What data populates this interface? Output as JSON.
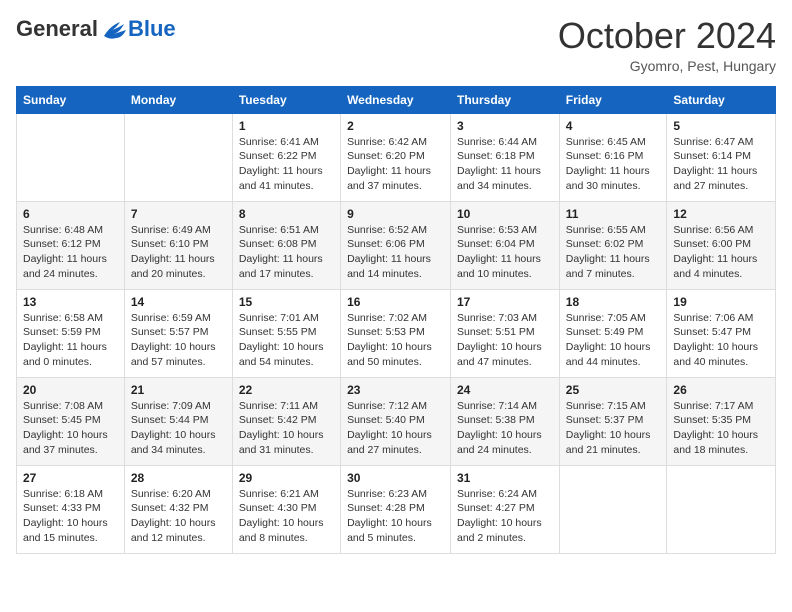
{
  "header": {
    "logo_general": "General",
    "logo_blue": "Blue",
    "month": "October 2024",
    "location": "Gyomro, Pest, Hungary"
  },
  "weekdays": [
    "Sunday",
    "Monday",
    "Tuesday",
    "Wednesday",
    "Thursday",
    "Friday",
    "Saturday"
  ],
  "weeks": [
    [
      {
        "day": "",
        "info": ""
      },
      {
        "day": "",
        "info": ""
      },
      {
        "day": "1",
        "info": "Sunrise: 6:41 AM\nSunset: 6:22 PM\nDaylight: 11 hours and 41 minutes."
      },
      {
        "day": "2",
        "info": "Sunrise: 6:42 AM\nSunset: 6:20 PM\nDaylight: 11 hours and 37 minutes."
      },
      {
        "day": "3",
        "info": "Sunrise: 6:44 AM\nSunset: 6:18 PM\nDaylight: 11 hours and 34 minutes."
      },
      {
        "day": "4",
        "info": "Sunrise: 6:45 AM\nSunset: 6:16 PM\nDaylight: 11 hours and 30 minutes."
      },
      {
        "day": "5",
        "info": "Sunrise: 6:47 AM\nSunset: 6:14 PM\nDaylight: 11 hours and 27 minutes."
      }
    ],
    [
      {
        "day": "6",
        "info": "Sunrise: 6:48 AM\nSunset: 6:12 PM\nDaylight: 11 hours and 24 minutes."
      },
      {
        "day": "7",
        "info": "Sunrise: 6:49 AM\nSunset: 6:10 PM\nDaylight: 11 hours and 20 minutes."
      },
      {
        "day": "8",
        "info": "Sunrise: 6:51 AM\nSunset: 6:08 PM\nDaylight: 11 hours and 17 minutes."
      },
      {
        "day": "9",
        "info": "Sunrise: 6:52 AM\nSunset: 6:06 PM\nDaylight: 11 hours and 14 minutes."
      },
      {
        "day": "10",
        "info": "Sunrise: 6:53 AM\nSunset: 6:04 PM\nDaylight: 11 hours and 10 minutes."
      },
      {
        "day": "11",
        "info": "Sunrise: 6:55 AM\nSunset: 6:02 PM\nDaylight: 11 hours and 7 minutes."
      },
      {
        "day": "12",
        "info": "Sunrise: 6:56 AM\nSunset: 6:00 PM\nDaylight: 11 hours and 4 minutes."
      }
    ],
    [
      {
        "day": "13",
        "info": "Sunrise: 6:58 AM\nSunset: 5:59 PM\nDaylight: 11 hours and 0 minutes."
      },
      {
        "day": "14",
        "info": "Sunrise: 6:59 AM\nSunset: 5:57 PM\nDaylight: 10 hours and 57 minutes."
      },
      {
        "day": "15",
        "info": "Sunrise: 7:01 AM\nSunset: 5:55 PM\nDaylight: 10 hours and 54 minutes."
      },
      {
        "day": "16",
        "info": "Sunrise: 7:02 AM\nSunset: 5:53 PM\nDaylight: 10 hours and 50 minutes."
      },
      {
        "day": "17",
        "info": "Sunrise: 7:03 AM\nSunset: 5:51 PM\nDaylight: 10 hours and 47 minutes."
      },
      {
        "day": "18",
        "info": "Sunrise: 7:05 AM\nSunset: 5:49 PM\nDaylight: 10 hours and 44 minutes."
      },
      {
        "day": "19",
        "info": "Sunrise: 7:06 AM\nSunset: 5:47 PM\nDaylight: 10 hours and 40 minutes."
      }
    ],
    [
      {
        "day": "20",
        "info": "Sunrise: 7:08 AM\nSunset: 5:45 PM\nDaylight: 10 hours and 37 minutes."
      },
      {
        "day": "21",
        "info": "Sunrise: 7:09 AM\nSunset: 5:44 PM\nDaylight: 10 hours and 34 minutes."
      },
      {
        "day": "22",
        "info": "Sunrise: 7:11 AM\nSunset: 5:42 PM\nDaylight: 10 hours and 31 minutes."
      },
      {
        "day": "23",
        "info": "Sunrise: 7:12 AM\nSunset: 5:40 PM\nDaylight: 10 hours and 27 minutes."
      },
      {
        "day": "24",
        "info": "Sunrise: 7:14 AM\nSunset: 5:38 PM\nDaylight: 10 hours and 24 minutes."
      },
      {
        "day": "25",
        "info": "Sunrise: 7:15 AM\nSunset: 5:37 PM\nDaylight: 10 hours and 21 minutes."
      },
      {
        "day": "26",
        "info": "Sunrise: 7:17 AM\nSunset: 5:35 PM\nDaylight: 10 hours and 18 minutes."
      }
    ],
    [
      {
        "day": "27",
        "info": "Sunrise: 6:18 AM\nSunset: 4:33 PM\nDaylight: 10 hours and 15 minutes."
      },
      {
        "day": "28",
        "info": "Sunrise: 6:20 AM\nSunset: 4:32 PM\nDaylight: 10 hours and 12 minutes."
      },
      {
        "day": "29",
        "info": "Sunrise: 6:21 AM\nSunset: 4:30 PM\nDaylight: 10 hours and 8 minutes."
      },
      {
        "day": "30",
        "info": "Sunrise: 6:23 AM\nSunset: 4:28 PM\nDaylight: 10 hours and 5 minutes."
      },
      {
        "day": "31",
        "info": "Sunrise: 6:24 AM\nSunset: 4:27 PM\nDaylight: 10 hours and 2 minutes."
      },
      {
        "day": "",
        "info": ""
      },
      {
        "day": "",
        "info": ""
      }
    ]
  ]
}
